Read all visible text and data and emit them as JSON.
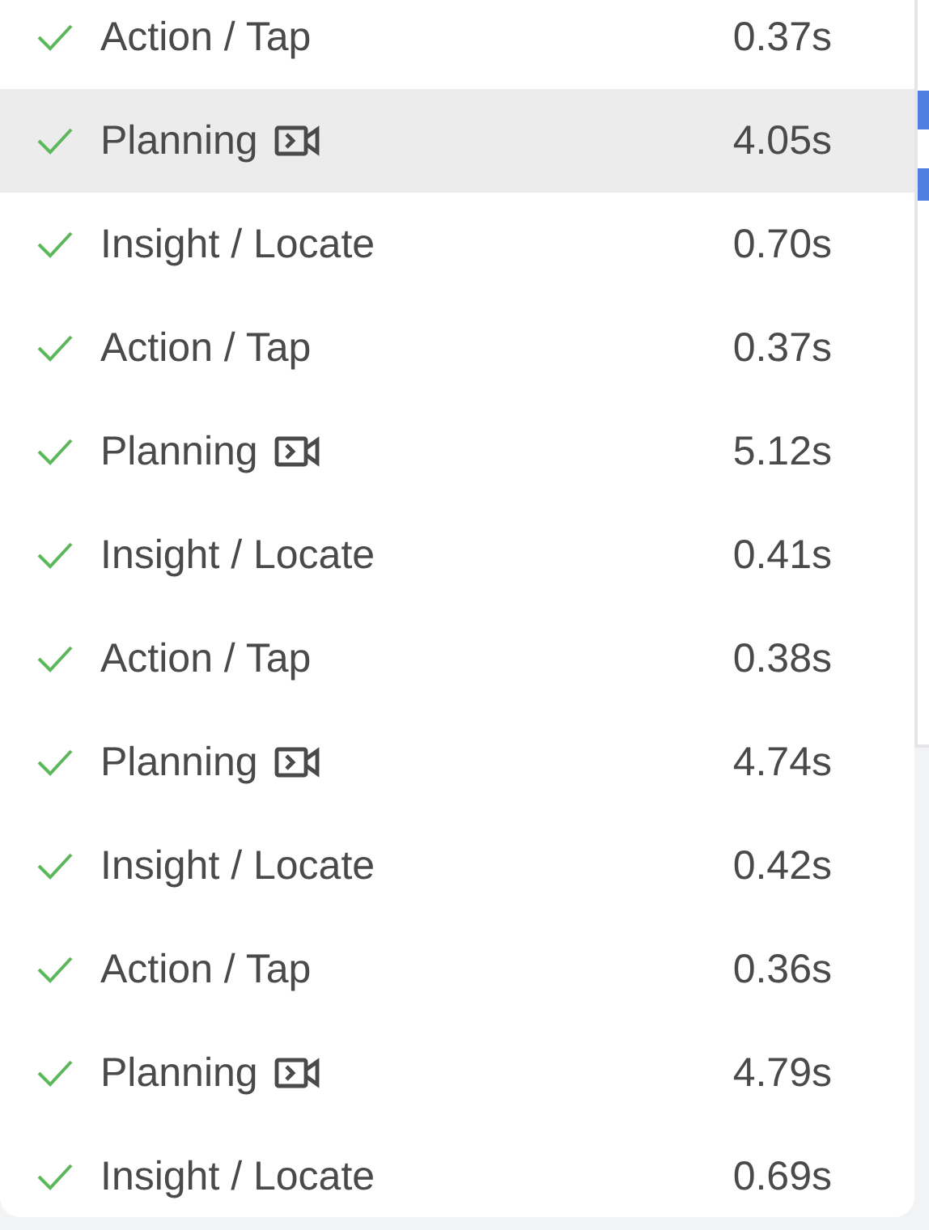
{
  "steps": [
    {
      "label": "Action / Tap",
      "kind": "plain",
      "time": "0.37s",
      "done": true,
      "selected": false
    },
    {
      "label": "Planning",
      "kind": "video",
      "time": "4.05s",
      "done": true,
      "selected": true
    },
    {
      "label": "Insight / Locate",
      "kind": "plain",
      "time": "0.70s",
      "done": true,
      "selected": false
    },
    {
      "label": "Action / Tap",
      "kind": "plain",
      "time": "0.37s",
      "done": true,
      "selected": false
    },
    {
      "label": "Planning",
      "kind": "video",
      "time": "5.12s",
      "done": true,
      "selected": false
    },
    {
      "label": "Insight / Locate",
      "kind": "plain",
      "time": "0.41s",
      "done": true,
      "selected": false
    },
    {
      "label": "Action / Tap",
      "kind": "plain",
      "time": "0.38s",
      "done": true,
      "selected": false
    },
    {
      "label": "Planning",
      "kind": "video",
      "time": "4.74s",
      "done": true,
      "selected": false
    },
    {
      "label": "Insight / Locate",
      "kind": "plain",
      "time": "0.42s",
      "done": true,
      "selected": false
    },
    {
      "label": "Action / Tap",
      "kind": "plain",
      "time": "0.36s",
      "done": true,
      "selected": false
    },
    {
      "label": "Planning",
      "kind": "video",
      "time": "4.79s",
      "done": true,
      "selected": false
    },
    {
      "label": "Insight / Locate",
      "kind": "plain",
      "time": "0.69s",
      "done": true,
      "selected": false
    }
  ]
}
